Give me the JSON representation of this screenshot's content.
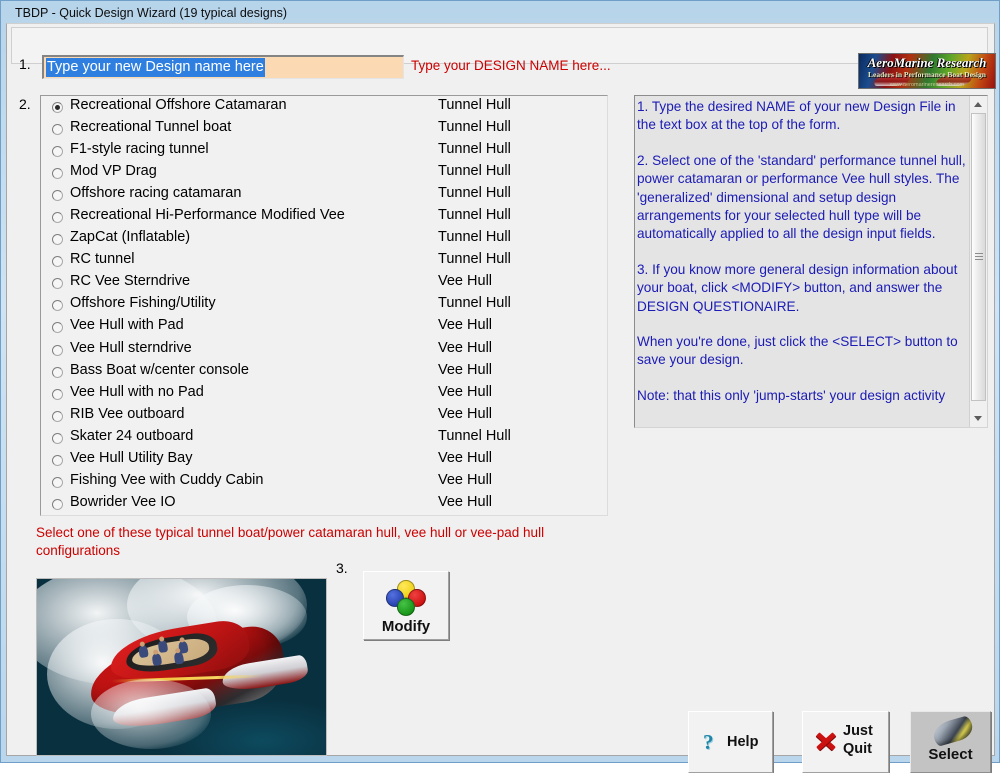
{
  "window": {
    "title": "TBDP - Quick Design Wizard (19 typical designs)"
  },
  "step1": {
    "number": "1.",
    "design_name_value": "Type your new Design name here",
    "hint": "Type your DESIGN NAME here..."
  },
  "logo": {
    "title": "AeroMarine Research",
    "tagline": "Leaders in Performance Boat Design",
    "url": "www.aeromarineresearch.com"
  },
  "step2": {
    "number": "2.",
    "selected_index": 0,
    "designs": [
      {
        "label": "Recreational Offshore Catamaran",
        "hull": "Tunnel Hull"
      },
      {
        "label": "Recreational Tunnel boat",
        "hull": "Tunnel Hull"
      },
      {
        "label": "F1-style racing tunnel",
        "hull": "Tunnel Hull"
      },
      {
        "label": "Mod VP Drag",
        "hull": "Tunnel Hull"
      },
      {
        "label": "Offshore racing catamaran",
        "hull": "Tunnel Hull"
      },
      {
        "label": "Recreational Hi-Performance Modified Vee",
        "hull": "Tunnel Hull"
      },
      {
        "label": "ZapCat (Inflatable)",
        "hull": "Tunnel Hull"
      },
      {
        "label": "RC tunnel",
        "hull": "Tunnel Hull"
      },
      {
        "label": "RC Vee Sterndrive",
        "hull": "Vee Hull"
      },
      {
        "label": "Offshore Fishing/Utility",
        "hull": "Tunnel Hull"
      },
      {
        "label": "Vee Hull with Pad",
        "hull": "Vee Hull"
      },
      {
        "label": "Vee Hull sterndrive",
        "hull": "Vee Hull"
      },
      {
        "label": "Bass Boat w/center console",
        "hull": "Vee Hull"
      },
      {
        "label": "Vee Hull with no Pad",
        "hull": "Vee Hull"
      },
      {
        "label": "RIB Vee outboard",
        "hull": "Vee Hull"
      },
      {
        "label": "Skater 24 outboard",
        "hull": "Tunnel Hull"
      },
      {
        "label": "Vee Hull Utility Bay",
        "hull": "Vee Hull"
      },
      {
        "label": "Fishing Vee with Cuddy Cabin",
        "hull": "Vee Hull"
      },
      {
        "label": "Bowrider Vee IO",
        "hull": "Vee Hull"
      }
    ],
    "hint": "Select one of these typical tunnel boat/power catamaran hull, vee hull or vee-pad hull configurations"
  },
  "instructions": {
    "paragraphs": [
      "1. Type the desired NAME of your new Design File in the text box at the top of the form.",
      "2. Select one of the 'standard' performance tunnel hull, power catamaran or performance Vee hull styles.  The 'generalized' dimensional and setup design arrangements for your selected hull type will be automatically applied to all the design input fields.",
      "3. If you know more general design information about your boat, click <MODIFY> button, and answer the DESIGN QUESTIONAIRE.",
      "When you're done, just click the <SELECT> button to save your design.",
      "Note: that this only 'jump-starts' your design activity"
    ]
  },
  "step3": {
    "number": "3.",
    "modify_label": "Modify"
  },
  "buttons": {
    "help_label": "Help",
    "help_icon_glyph": "?",
    "quit_label_line1": "Just",
    "quit_label_line2": "Quit",
    "select_label": "Select"
  },
  "colors": {
    "hint_red": "#cc0000",
    "instruction_blue": "#1b1bb5",
    "input_background": "#fbd9b3",
    "selection_blue": "#2f7fe0",
    "window_chrome": "#b6d4ea"
  }
}
